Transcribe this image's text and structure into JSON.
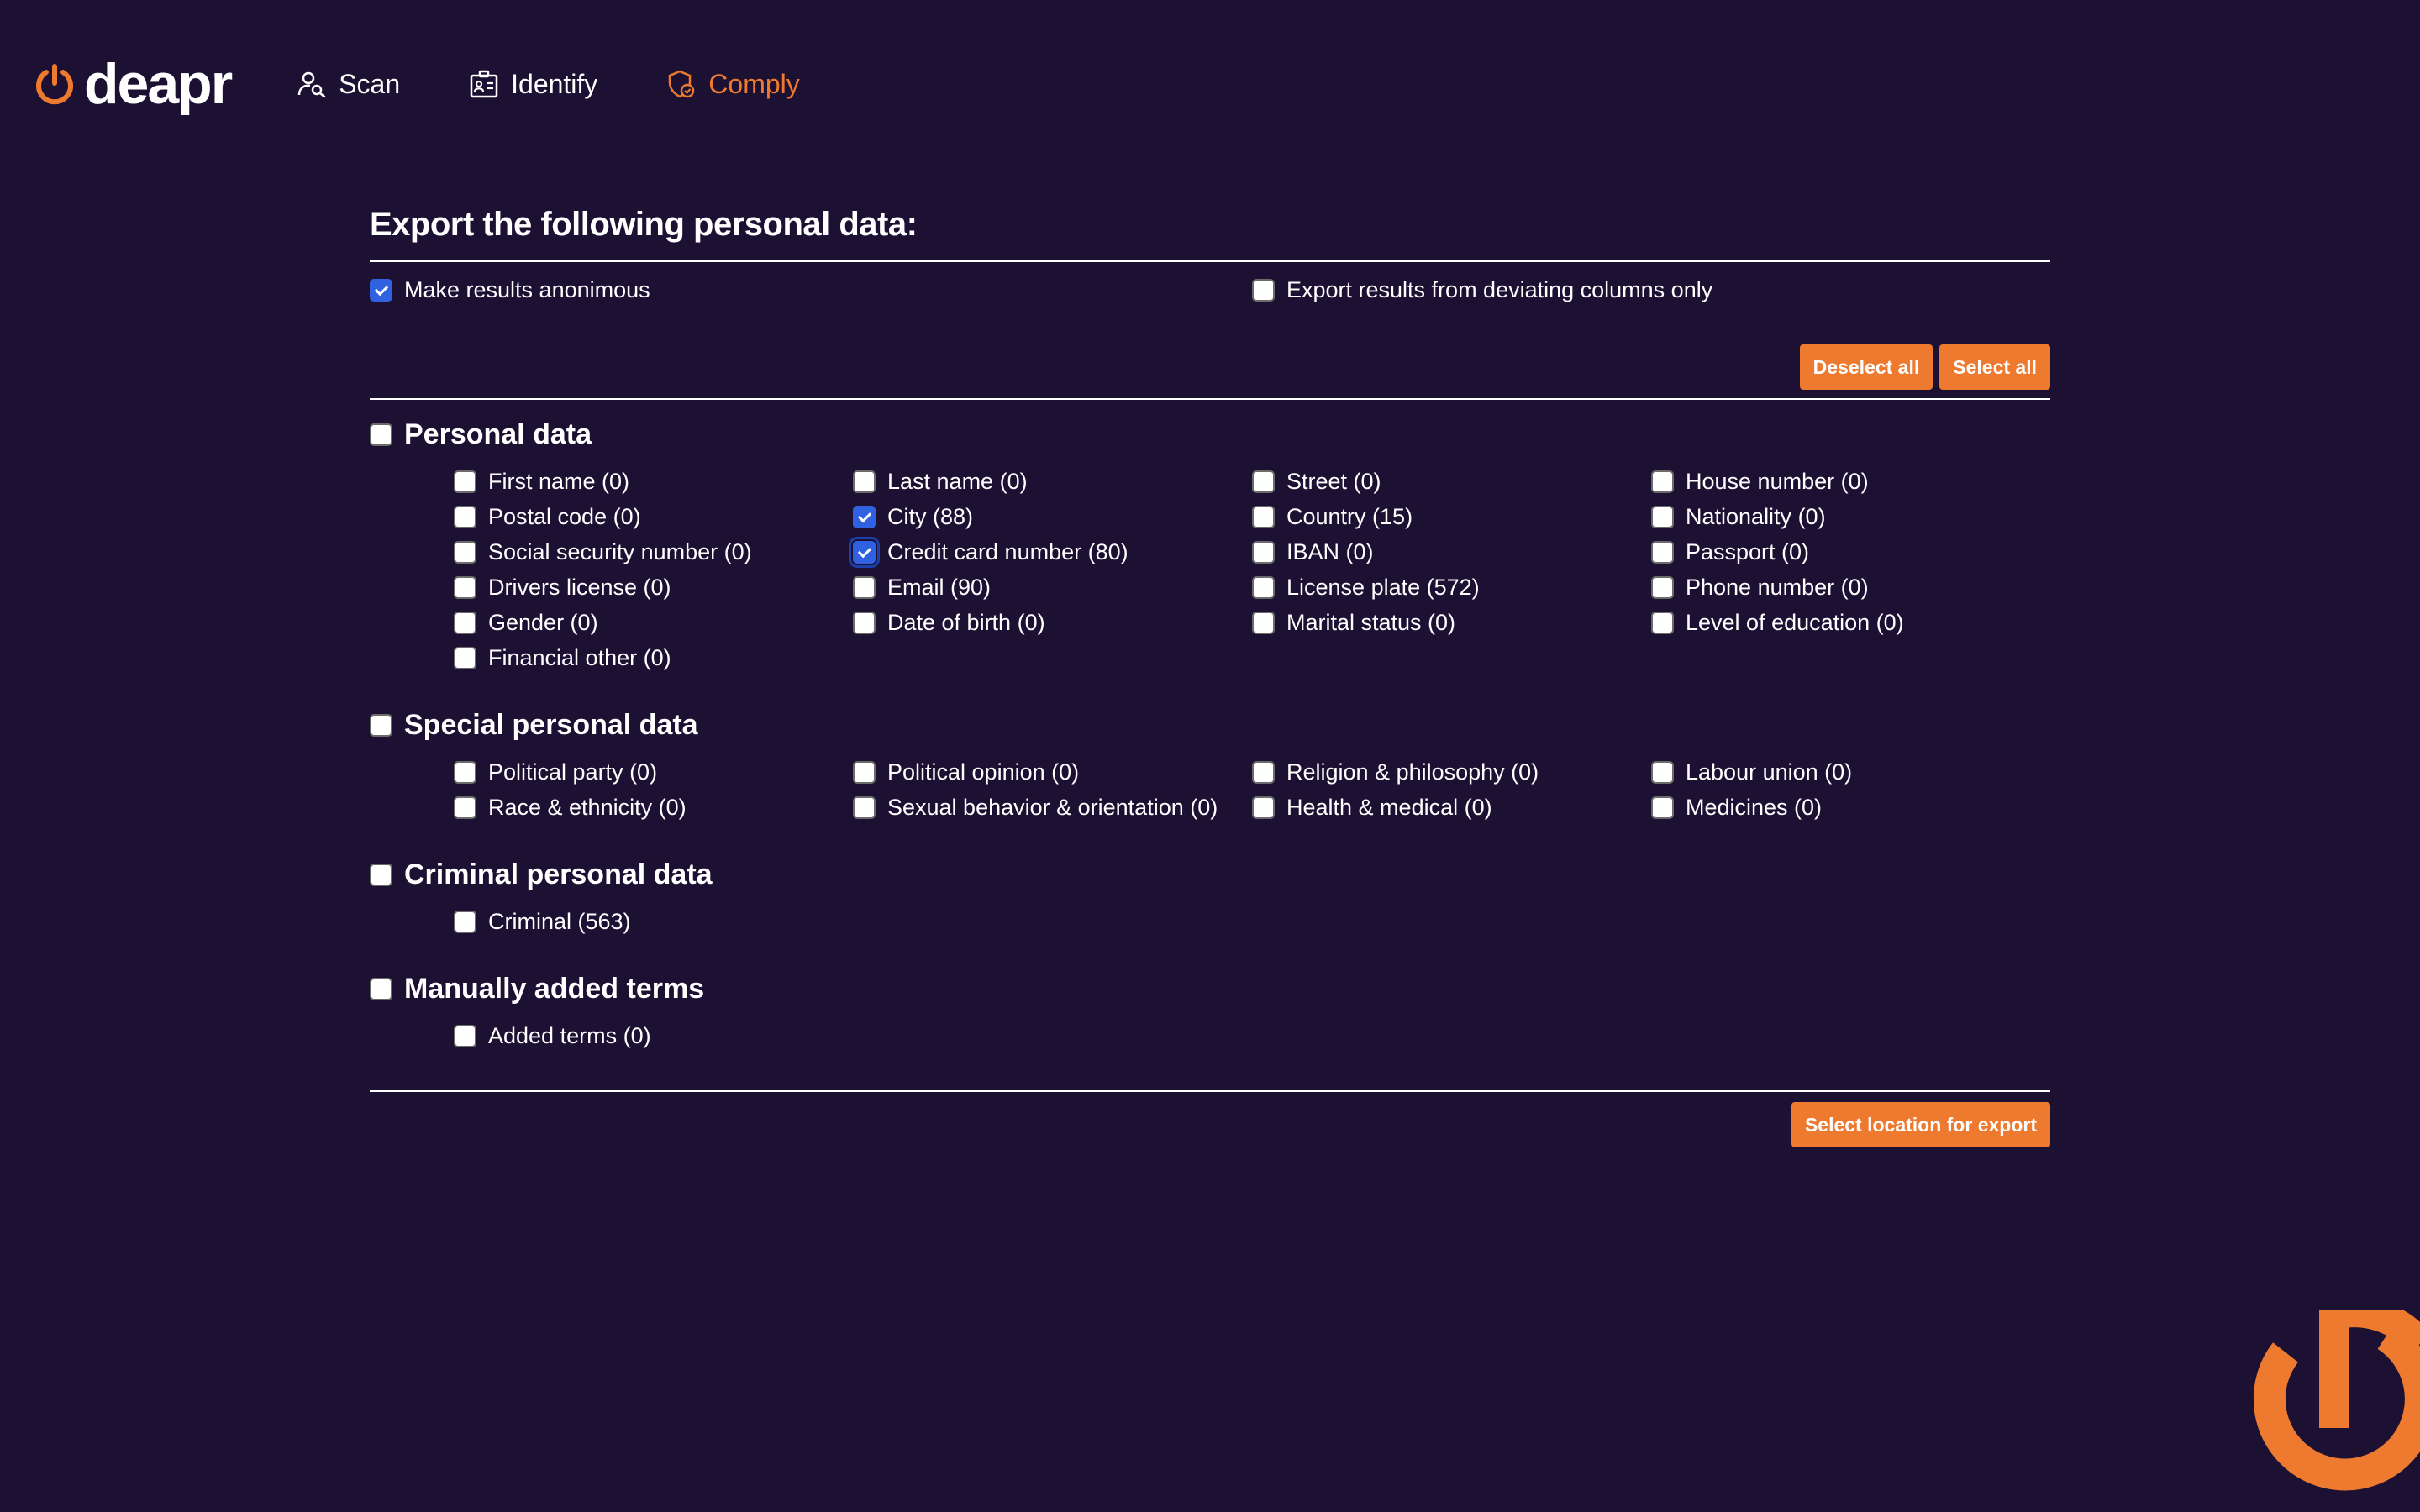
{
  "brand": {
    "name": "deapr",
    "accent": "#ee7a2f",
    "background": "#1c1033"
  },
  "nav": [
    {
      "label": "Scan",
      "icon": "user-search-icon",
      "active": false
    },
    {
      "label": "Identify",
      "icon": "id-card-icon",
      "active": false
    },
    {
      "label": "Comply",
      "icon": "shield-check-icon",
      "active": true
    }
  ],
  "export": {
    "title": "Export the following personal data:",
    "anonymous_label": "Make results anonimous",
    "anonymous_checked": true,
    "deviating_label": "Export results from deviating columns only",
    "deviating_checked": false,
    "deselect_all_label": "Deselect all",
    "select_all_label": "Select all",
    "export_button_label": "Select location for export"
  },
  "sections": [
    {
      "title": "Personal data",
      "checked": false,
      "items": [
        {
          "label": "First name (0)",
          "checked": false
        },
        {
          "label": "Last name (0)",
          "checked": false
        },
        {
          "label": "Street (0)",
          "checked": false
        },
        {
          "label": "House number (0)",
          "checked": false
        },
        {
          "label": "Postal code (0)",
          "checked": false
        },
        {
          "label": "City (88)",
          "checked": true
        },
        {
          "label": "Country (15)",
          "checked": false
        },
        {
          "label": "Nationality (0)",
          "checked": false
        },
        {
          "label": "Social security number (0)",
          "checked": false
        },
        {
          "label": "Credit card number (80)",
          "checked": true
        },
        {
          "label": "IBAN (0)",
          "checked": false
        },
        {
          "label": "Passport (0)",
          "checked": false
        },
        {
          "label": "Drivers license (0)",
          "checked": false
        },
        {
          "label": "Email (90)",
          "checked": false
        },
        {
          "label": "License plate (572)",
          "checked": false
        },
        {
          "label": "Phone number (0)",
          "checked": false
        },
        {
          "label": "Gender (0)",
          "checked": false
        },
        {
          "label": "Date of birth (0)",
          "checked": false
        },
        {
          "label": "Marital status (0)",
          "checked": false
        },
        {
          "label": "Level of education (0)",
          "checked": false
        },
        {
          "label": "Financial other (0)",
          "checked": false
        }
      ]
    },
    {
      "title": "Special personal data",
      "checked": false,
      "items": [
        {
          "label": "Political party (0)",
          "checked": false
        },
        {
          "label": "Political opinion (0)",
          "checked": false
        },
        {
          "label": "Religion & philosophy (0)",
          "checked": false
        },
        {
          "label": "Labour union (0)",
          "checked": false
        },
        {
          "label": "Race & ethnicity (0)",
          "checked": false
        },
        {
          "label": "Sexual behavior & orientation (0)",
          "checked": false
        },
        {
          "label": "Health & medical (0)",
          "checked": false
        },
        {
          "label": "Medicines (0)",
          "checked": false
        }
      ]
    },
    {
      "title": "Criminal personal data",
      "checked": false,
      "items": [
        {
          "label": "Criminal (563)",
          "checked": false
        }
      ]
    },
    {
      "title": "Manually added terms",
      "checked": false,
      "items": [
        {
          "label": "Added terms (0)",
          "checked": false
        }
      ]
    }
  ]
}
